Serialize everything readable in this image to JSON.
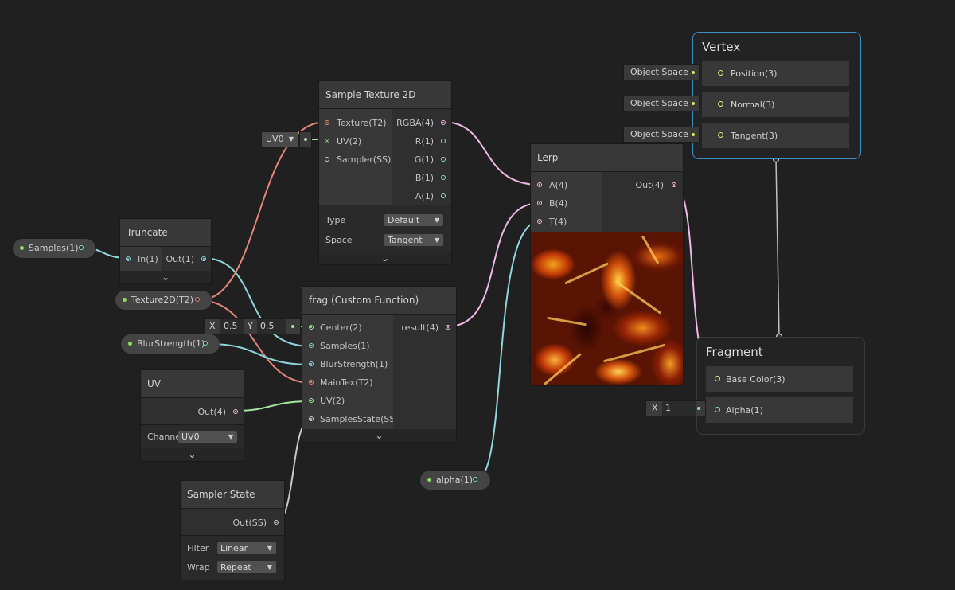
{
  "nodes": {
    "sample_texture": {
      "title": "Sample Texture 2D",
      "inputs": [
        "Texture(T2)",
        "UV(2)",
        "Sampler(SS)"
      ],
      "outputs": [
        "RGBA(4)",
        "R(1)",
        "G(1)",
        "B(1)",
        "A(1)"
      ],
      "type_label": "Type",
      "type_value": "Default",
      "space_label": "Space",
      "space_value": "Tangent",
      "uv_dropdown": "UV0"
    },
    "truncate": {
      "title": "Truncate",
      "input": "In(1)",
      "output": "Out(1)"
    },
    "frag": {
      "title": "frag (Custom Function)",
      "inputs": [
        "Center(2)",
        "Samples(1)",
        "BlurStrength(1)",
        "MainTex(T2)",
        "UV(2)",
        "SamplesState(SS)"
      ],
      "output": "result(4)",
      "center_x_label": "X",
      "center_x": "0.5",
      "center_y_label": "Y",
      "center_y": "0.5"
    },
    "lerp": {
      "title": "Lerp",
      "inputs": [
        "A(4)",
        "B(4)",
        "T(4)"
      ],
      "output": "Out(4)"
    },
    "uv": {
      "title": "UV",
      "output": "Out(4)",
      "channel_label": "Channe",
      "channel_value": "UV0"
    },
    "sampler_state": {
      "title": "Sampler State",
      "output": "Out(SS)",
      "filter_label": "Filter",
      "filter_value": "Linear",
      "wrap_label": "Wrap",
      "wrap_value": "Repeat"
    }
  },
  "properties": {
    "samples": "Samples(1)",
    "texture2d": "Texture2D(T2)",
    "blur_strength": "BlurStrength(1)",
    "alpha": "alpha(1)"
  },
  "vertex": {
    "title": "Vertex",
    "slots": [
      {
        "label": "Position(3)",
        "space": "Object Space"
      },
      {
        "label": "Normal(3)",
        "space": "Object Space"
      },
      {
        "label": "Tangent(3)",
        "space": "Object Space"
      }
    ]
  },
  "fragment": {
    "title": "Fragment",
    "slots": [
      "Base Color(3)",
      "Alpha(1)"
    ],
    "alpha_x_label": "X",
    "alpha_value": "1"
  },
  "colors": {
    "background": "#202020",
    "node_body": "#2d2d2d",
    "wire_texture": "#e5857a",
    "wire_vector1": "#8fd6dc",
    "wire_vector2": "#a6e3a2",
    "wire_vector4": "#f0b9e4",
    "wire_sampler": "#c8c8c8",
    "wire_vector3": "#e5e58c",
    "master_border": "#3e8ec8"
  }
}
